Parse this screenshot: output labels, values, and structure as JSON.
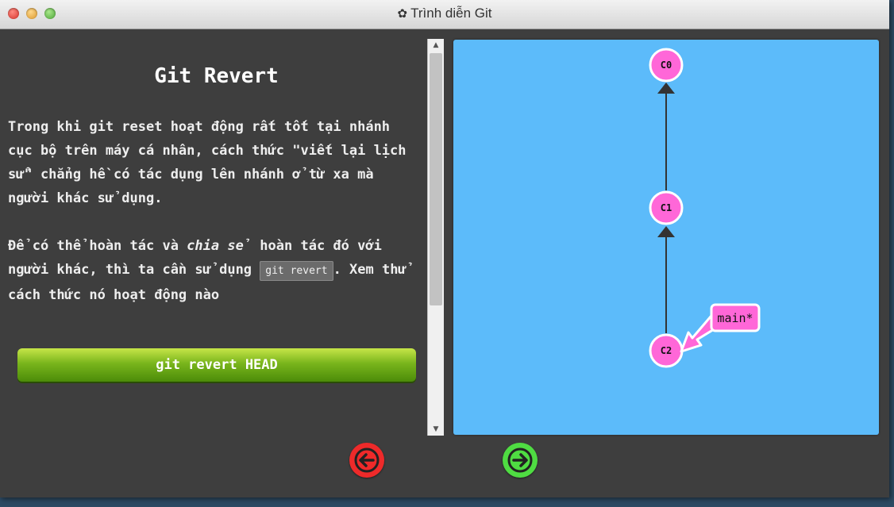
{
  "window": {
    "title": "Trình diễn Git",
    "title_icon": "gear-icon"
  },
  "lesson": {
    "title": "Git Revert",
    "para1": "Trong khi git reset hoạt động rất tốt tại nhánh cục bộ trên máy cá nhân, cách thức \"viết lại lịch sử\" chẳng hề có tác dụng lên nhánh ở từ xa mà người khác sử dụng.",
    "para2_a": "Để có thể hoàn tác và ",
    "para2_em": "chia sẻ",
    "para2_b": " hoàn tác đó với người khác, thì ta cần sử dụng ",
    "para2_code": "git revert",
    "para2_c": ". Xem thử cách thức nó hoạt động nào",
    "run_button": "git revert HEAD"
  },
  "graph": {
    "commits": [
      {
        "id": "C0"
      },
      {
        "id": "C1"
      },
      {
        "id": "C2"
      }
    ],
    "branch": {
      "name": "main*",
      "target": "C2"
    },
    "colors": {
      "background": "#5cbbfa",
      "commit_fill": "#ff67d8",
      "branch_fill": "#ff67d8",
      "edge": "#333333"
    }
  },
  "nav": {
    "prev_icon": "arrow-left-icon",
    "next_icon": "arrow-right-icon",
    "prev_color": "#ee2a2a",
    "next_color": "#4fdc42"
  }
}
